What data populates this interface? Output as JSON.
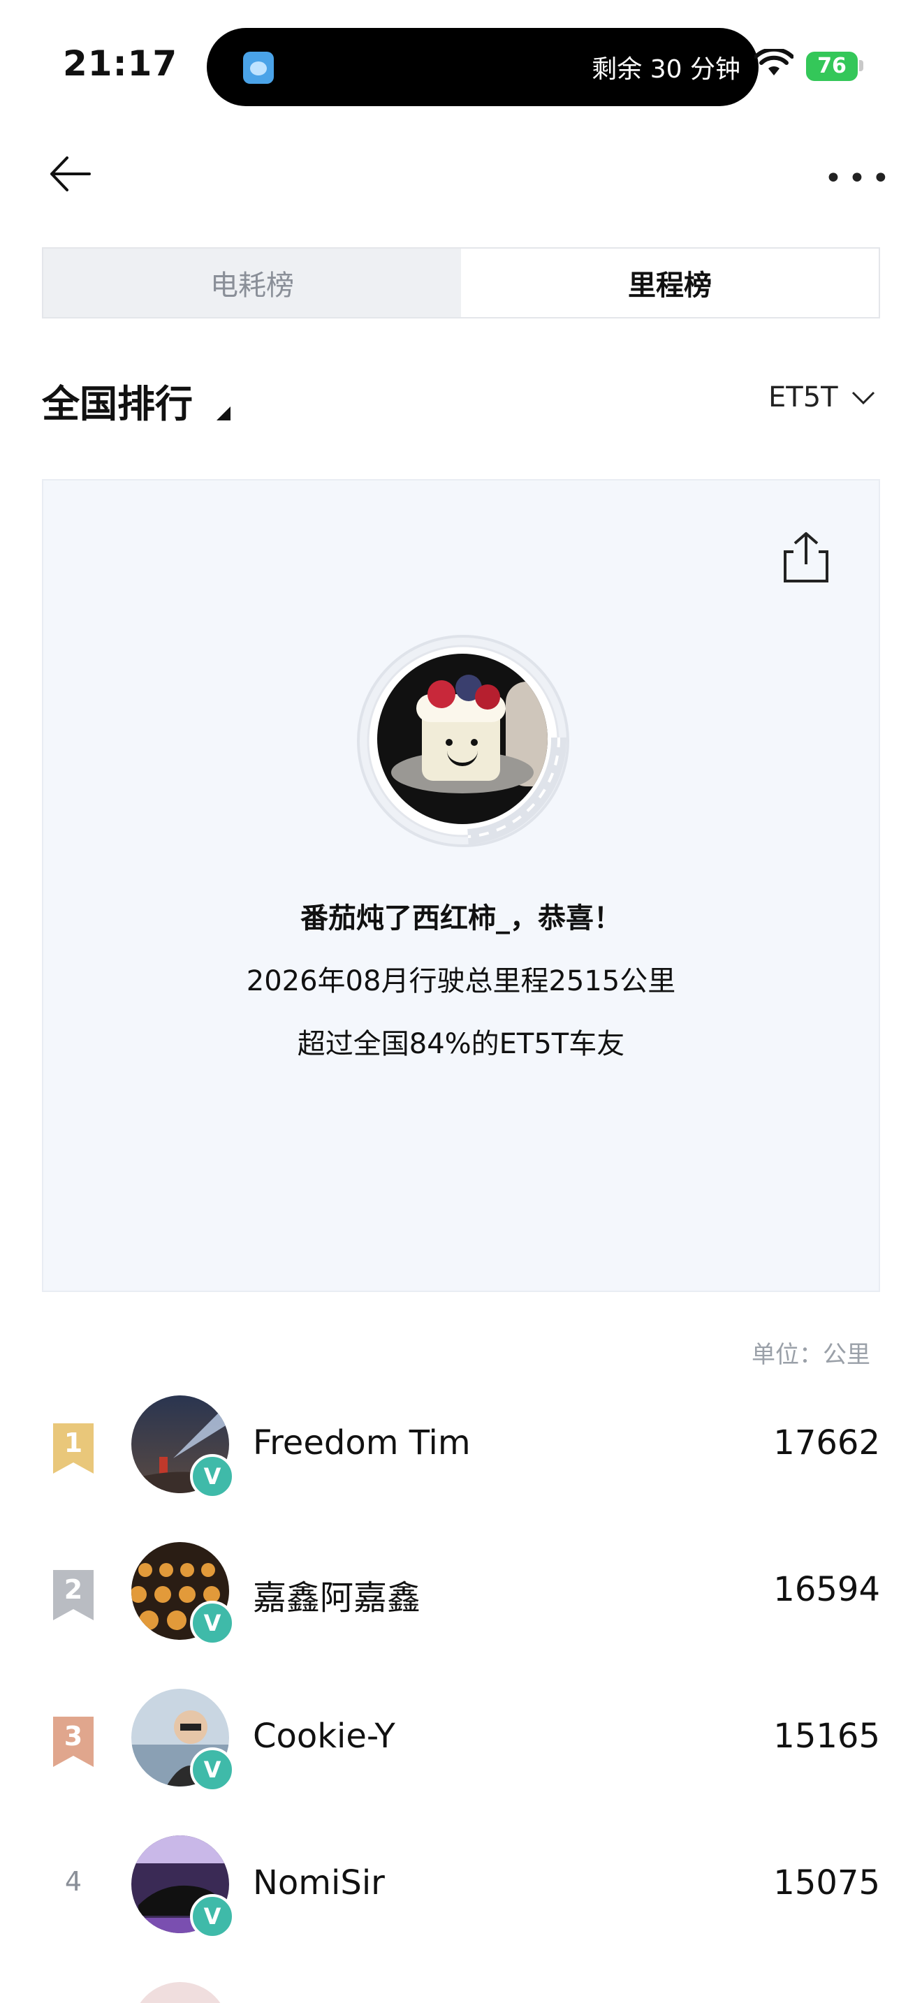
{
  "status": {
    "time": "21:17",
    "island_text": "剩余 30 分钟",
    "battery": "76"
  },
  "tabs": [
    {
      "label": "电耗榜",
      "active": false
    },
    {
      "label": "里程榜",
      "active": true
    }
  ],
  "filter": {
    "region": "全国排行",
    "model": "ET5T"
  },
  "card": {
    "congrats": "番茄炖了西红柿_，恭喜！",
    "mileage_line": "2026年08月行驶总里程2515公里",
    "percentile_line": "超过全国84%的ET5T车友"
  },
  "unit_label": "单位：公里",
  "rankings": [
    {
      "rank": "1",
      "name": "Freedom Tim",
      "score": "17662",
      "badge_color": "#e9c77a"
    },
    {
      "rank": "2",
      "name": "嘉鑫阿嘉鑫",
      "score": "16594",
      "badge_color": "#b9bcc2"
    },
    {
      "rank": "3",
      "name": "Cookie-Y",
      "score": "15165",
      "badge_color": "#e0a68d"
    },
    {
      "rank": "4",
      "name": "NomiSir",
      "score": "15075"
    }
  ],
  "verified_label": "V",
  "colors": {
    "accent_teal": "#3fbaa9",
    "card_bg": "#f4f7fc"
  }
}
